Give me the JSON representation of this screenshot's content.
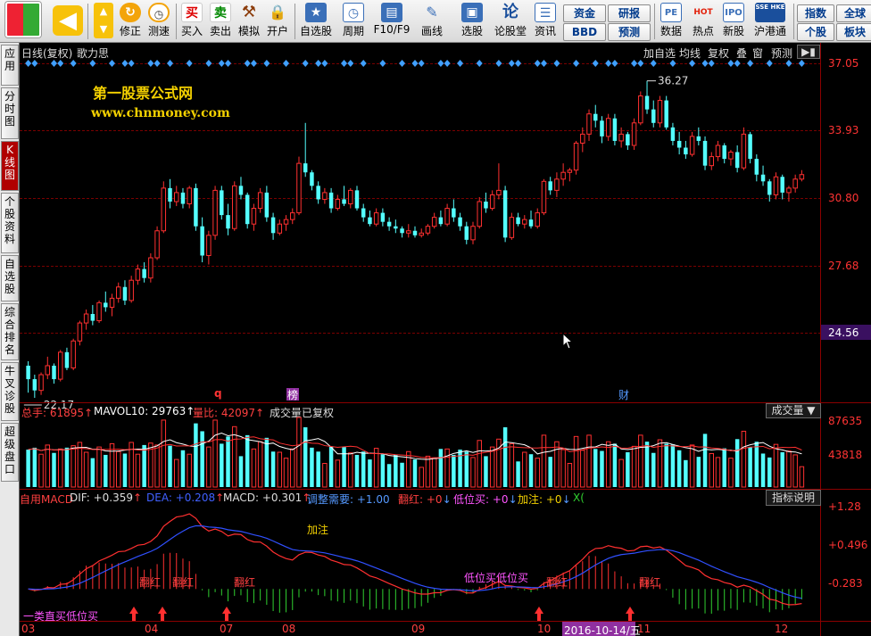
{
  "toolbar": {
    "items": [
      {
        "id": "back",
        "label": ""
      },
      {
        "id": "up",
        "label": ""
      },
      {
        "id": "revise",
        "label": "修正"
      },
      {
        "id": "test",
        "label": "测速"
      },
      {
        "id": "buy",
        "label": "买入",
        "icon_text": "买"
      },
      {
        "id": "sell",
        "label": "卖出",
        "icon_text": "卖"
      },
      {
        "id": "simulate",
        "label": "模拟"
      },
      {
        "id": "open",
        "label": "开户"
      },
      {
        "id": "watchlist",
        "label": "自选股"
      },
      {
        "id": "period",
        "label": "周期"
      },
      {
        "id": "f10",
        "label": "F10/F9"
      },
      {
        "id": "draw",
        "label": "画线"
      },
      {
        "id": "pick",
        "label": "选股"
      },
      {
        "id": "forum",
        "label": "论股堂",
        "icon_text": "论"
      },
      {
        "id": "info",
        "label": "资讯"
      },
      {
        "id": "data",
        "label": "数据",
        "icon_text": "PE"
      },
      {
        "id": "hot",
        "label": "热点",
        "icon_text": "HOT"
      },
      {
        "id": "newstock",
        "label": "新股"
      },
      {
        "id": "hk",
        "label": "沪港通",
        "icon_text": "SSE HKE"
      }
    ],
    "small_buttons": [
      {
        "id": "fund",
        "label": "资金"
      },
      {
        "id": "report",
        "label": "研报"
      },
      {
        "id": "bbd",
        "label": "BBD"
      },
      {
        "id": "forecast",
        "label": "预测"
      },
      {
        "id": "index",
        "label": "指数"
      },
      {
        "id": "market",
        "label": "全球"
      },
      {
        "id": "stock",
        "label": "个股"
      },
      {
        "id": "sector",
        "label": "板块"
      }
    ]
  },
  "sidebar": {
    "tabs": [
      {
        "label": "应用"
      },
      {
        "label": "分时图"
      },
      {
        "label": "K线图",
        "active": true
      },
      {
        "label": "个股资料"
      },
      {
        "label": "自选股"
      },
      {
        "label": "综合排名"
      },
      {
        "label": "牛叉诊股"
      },
      {
        "label": "超级盘口"
      }
    ]
  },
  "chart_header": {
    "period_label": "日线(复权)",
    "stock_name": "歌力思",
    "right_buttons": [
      "加自选",
      "均线",
      "复权",
      "叠",
      "窗",
      "预测"
    ],
    "watermark_line1": "第一股票公式网",
    "watermark_line2": "www.chnmoney.com"
  },
  "price_axis": {
    "labels": [
      "37.05",
      "33.93",
      "30.80",
      "27.68",
      "24.56"
    ],
    "highlight": "24.56",
    "high_mark": "36.27",
    "low_mark": "22.17"
  },
  "event_marks": [
    {
      "text": "q",
      "color": "#ff3333"
    },
    {
      "text": "榜",
      "color": "#ff55ff"
    },
    {
      "text": "财",
      "color": "#5599ff"
    }
  ],
  "volume_header": {
    "total": "总手: 61895",
    "mavol": "MAVOL10: 29763",
    "ratio": "量比: 42097",
    "note": "成交量已复权",
    "dropdown": "成交量",
    "axis": [
      "87635",
      "43818"
    ]
  },
  "macd_header": {
    "name": "自用MACD",
    "dif": "DIF: +0.359",
    "dea": "DEA: +0.208",
    "macd": "MACD: +0.301",
    "adjust": "调整需要: +1.00",
    "flip": "翻红: +0",
    "lowbuy": "低位买: +0",
    "add": "加注: +0",
    "x": "X(",
    "explain_button": "指标说明",
    "axis": [
      "+1.28",
      "+0.496",
      "-0.283"
    ]
  },
  "macd_annotations": {
    "flip_red": "翻红",
    "add": "加注",
    "low_buy": "低位买",
    "low_buy_double": "低位买低位买",
    "bottom_left": "一类直买低位买"
  },
  "date_axis": {
    "labels": [
      "03",
      "04",
      "07",
      "08",
      "09",
      "10",
      "11",
      "12"
    ],
    "highlight": "2016-10-14/五"
  },
  "chart_data": {
    "type": "candlestick",
    "ylim": [
      22.17,
      37.05
    ],
    "ohlc": [
      [
        23.6,
        23.8,
        22.4,
        23.0
      ],
      [
        23.0,
        23.2,
        22.17,
        22.5
      ],
      [
        22.5,
        23.3,
        22.3,
        23.2
      ],
      [
        23.2,
        24.0,
        23.0,
        23.6
      ],
      [
        23.6,
        23.7,
        22.8,
        23.0
      ],
      [
        23.0,
        24.3,
        22.9,
        24.2
      ],
      [
        24.2,
        24.4,
        23.4,
        23.5
      ],
      [
        23.5,
        24.8,
        23.4,
        24.7
      ],
      [
        24.7,
        25.6,
        24.5,
        25.5
      ],
      [
        25.5,
        26.1,
        25.2,
        25.9
      ],
      [
        25.9,
        26.3,
        25.4,
        25.6
      ],
      [
        25.6,
        26.5,
        25.5,
        26.4
      ],
      [
        26.4,
        26.9,
        26.0,
        26.2
      ],
      [
        26.2,
        26.8,
        25.8,
        26.6
      ],
      [
        26.6,
        27.3,
        26.4,
        27.1
      ],
      [
        27.1,
        27.4,
        26.3,
        26.5
      ],
      [
        26.5,
        27.6,
        26.4,
        27.4
      ],
      [
        27.4,
        28.1,
        27.2,
        27.9
      ],
      [
        27.9,
        28.2,
        27.3,
        27.5
      ],
      [
        27.5,
        28.6,
        27.3,
        28.4
      ],
      [
        28.4,
        29.8,
        28.3,
        29.6
      ],
      [
        29.6,
        31.8,
        29.5,
        31.5
      ],
      [
        31.5,
        31.9,
        30.6,
        30.9
      ],
      [
        30.9,
        31.6,
        30.7,
        31.3
      ],
      [
        31.3,
        31.5,
        30.6,
        30.8
      ],
      [
        30.8,
        31.6,
        30.6,
        31.5
      ],
      [
        31.5,
        31.7,
        29.6,
        29.8
      ],
      [
        29.8,
        30.2,
        28.2,
        28.5
      ],
      [
        28.5,
        29.6,
        28.1,
        29.4
      ],
      [
        29.4,
        31.6,
        29.2,
        31.4
      ],
      [
        31.4,
        31.6,
        30.1,
        30.3
      ],
      [
        30.3,
        30.8,
        29.4,
        29.7
      ],
      [
        29.7,
        31.8,
        29.6,
        31.6
      ],
      [
        31.6,
        32.0,
        31.0,
        31.2
      ],
      [
        31.2,
        31.3,
        29.7,
        29.9
      ],
      [
        29.9,
        30.8,
        29.6,
        30.6
      ],
      [
        30.6,
        31.5,
        30.4,
        31.3
      ],
      [
        31.3,
        31.6,
        30.0,
        30.2
      ],
      [
        30.2,
        30.4,
        29.2,
        29.5
      ],
      [
        29.5,
        30.1,
        29.4,
        29.9
      ],
      [
        29.9,
        30.3,
        29.6,
        30.1
      ],
      [
        30.1,
        30.6,
        29.9,
        30.4
      ],
      [
        30.4,
        32.9,
        30.3,
        32.6
      ],
      [
        32.6,
        34.4,
        32.0,
        32.2
      ],
      [
        32.2,
        32.3,
        31.4,
        31.6
      ],
      [
        31.6,
        31.8,
        30.8,
        31.0
      ],
      [
        31.0,
        31.5,
        30.8,
        31.3
      ],
      [
        31.3,
        31.5,
        30.4,
        30.6
      ],
      [
        30.6,
        31.2,
        30.5,
        31.0
      ],
      [
        31.0,
        31.6,
        30.7,
        30.8
      ],
      [
        30.8,
        31.5,
        30.6,
        31.4
      ],
      [
        31.4,
        31.6,
        30.5,
        30.6
      ],
      [
        30.6,
        30.8,
        30.0,
        30.2
      ],
      [
        30.2,
        30.5,
        29.8,
        29.9
      ],
      [
        29.9,
        30.6,
        29.8,
        30.4
      ],
      [
        30.4,
        30.6,
        29.8,
        30.0
      ],
      [
        30.0,
        30.2,
        29.6,
        29.8
      ],
      [
        29.8,
        30.1,
        29.5,
        29.7
      ],
      [
        29.7,
        29.8,
        29.3,
        29.5
      ],
      [
        29.5,
        29.9,
        29.3,
        29.6
      ],
      [
        29.6,
        29.8,
        29.3,
        29.4
      ],
      [
        29.4,
        29.7,
        29.3,
        29.5
      ],
      [
        29.5,
        29.9,
        29.4,
        29.8
      ],
      [
        29.8,
        30.4,
        29.7,
        30.2
      ],
      [
        30.2,
        30.5,
        29.8,
        29.9
      ],
      [
        29.9,
        30.8,
        29.8,
        30.6
      ],
      [
        30.6,
        31.0,
        30.0,
        30.2
      ],
      [
        30.2,
        30.4,
        29.6,
        29.8
      ],
      [
        29.8,
        30.0,
        29.0,
        29.2
      ],
      [
        29.2,
        30.0,
        29.0,
        29.8
      ],
      [
        29.8,
        31.1,
        29.7,
        30.9
      ],
      [
        30.9,
        31.3,
        30.4,
        30.6
      ],
      [
        30.6,
        31.4,
        30.5,
        31.2
      ],
      [
        31.2,
        32.6,
        31.0,
        31.4
      ],
      [
        31.4,
        31.6,
        29.1,
        29.3
      ],
      [
        29.3,
        30.4,
        29.2,
        30.2
      ],
      [
        30.2,
        30.4,
        29.8,
        29.9
      ],
      [
        29.9,
        30.3,
        29.7,
        30.1
      ],
      [
        30.1,
        30.5,
        29.7,
        29.8
      ],
      [
        29.8,
        30.6,
        29.7,
        30.4
      ],
      [
        30.4,
        31.9,
        30.3,
        31.8
      ],
      [
        31.8,
        32.0,
        31.2,
        31.4
      ],
      [
        31.4,
        32.2,
        31.1,
        31.9
      ],
      [
        31.9,
        32.6,
        31.6,
        32.2
      ],
      [
        32.2,
        32.4,
        31.8,
        32.3
      ],
      [
        32.3,
        33.6,
        32.1,
        33.5
      ],
      [
        33.5,
        34.2,
        33.1,
        33.9
      ],
      [
        33.9,
        35.0,
        33.6,
        34.8
      ],
      [
        34.8,
        35.2,
        34.2,
        34.5
      ],
      [
        34.5,
        34.7,
        33.5,
        33.8
      ],
      [
        33.8,
        34.8,
        33.6,
        34.6
      ],
      [
        34.6,
        34.8,
        33.4,
        33.6
      ],
      [
        33.6,
        34.2,
        33.3,
        33.9
      ],
      [
        33.9,
        34.0,
        33.2,
        33.4
      ],
      [
        33.4,
        34.6,
        33.2,
        34.4
      ],
      [
        34.4,
        35.8,
        34.3,
        35.6
      ],
      [
        35.6,
        36.27,
        34.8,
        35.0
      ],
      [
        35.0,
        35.4,
        34.2,
        34.4
      ],
      [
        34.4,
        35.6,
        34.2,
        35.4
      ],
      [
        35.4,
        35.6,
        34.1,
        34.2
      ],
      [
        34.2,
        34.4,
        33.4,
        33.6
      ],
      [
        33.6,
        34.0,
        33.0,
        33.3
      ],
      [
        33.3,
        33.6,
        32.8,
        33.0
      ],
      [
        33.0,
        34.0,
        32.9,
        33.8
      ],
      [
        33.8,
        34.2,
        33.4,
        33.6
      ],
      [
        33.6,
        33.8,
        32.3,
        32.5
      ],
      [
        32.5,
        33.1,
        32.3,
        32.9
      ],
      [
        32.9,
        33.6,
        32.7,
        33.4
      ],
      [
        33.4,
        33.5,
        32.6,
        32.8
      ],
      [
        32.8,
        33.2,
        32.5,
        33.1
      ],
      [
        33.1,
        33.4,
        32.2,
        32.4
      ],
      [
        32.4,
        34.2,
        32.3,
        33.9
      ],
      [
        33.9,
        34.0,
        32.6,
        32.8
      ],
      [
        32.8,
        33.0,
        31.8,
        32.1
      ],
      [
        32.1,
        32.5,
        31.6,
        31.8
      ],
      [
        31.8,
        31.9,
        30.9,
        31.2
      ],
      [
        31.2,
        32.2,
        31.0,
        32.0
      ],
      [
        32.0,
        32.1,
        31.0,
        31.3
      ],
      [
        31.3,
        31.6,
        30.9,
        31.5
      ],
      [
        31.5,
        32.1,
        31.3,
        31.9
      ],
      [
        31.9,
        32.3,
        31.8,
        32.1
      ]
    ]
  }
}
